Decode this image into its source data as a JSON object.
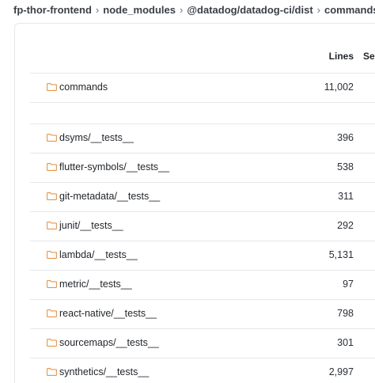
{
  "breadcrumb": [
    "fp-thor-frontend",
    "node_modules",
    "@datadog/datadog-ci/dist",
    "commands"
  ],
  "breadcrumb_separator": "›",
  "table": {
    "headers": {
      "lines": "Lines",
      "second": "Se"
    },
    "current": {
      "name": "commands",
      "lines": "11,002"
    },
    "rows": [
      {
        "name": "dsyms/__tests__",
        "lines": "396"
      },
      {
        "name": "flutter-symbols/__tests__",
        "lines": "538"
      },
      {
        "name": "git-metadata/__tests__",
        "lines": "311"
      },
      {
        "name": "junit/__tests__",
        "lines": "292"
      },
      {
        "name": "lambda/__tests__",
        "lines": "5,131"
      },
      {
        "name": "metric/__tests__",
        "lines": "97"
      },
      {
        "name": "react-native/__tests__",
        "lines": "798"
      },
      {
        "name": "sourcemaps/__tests__",
        "lines": "301"
      },
      {
        "name": "synthetics/__tests__",
        "lines": "2,997"
      }
    ]
  },
  "colors": {
    "folder_icon": "#e8954a",
    "border": "#e5e7eb"
  }
}
